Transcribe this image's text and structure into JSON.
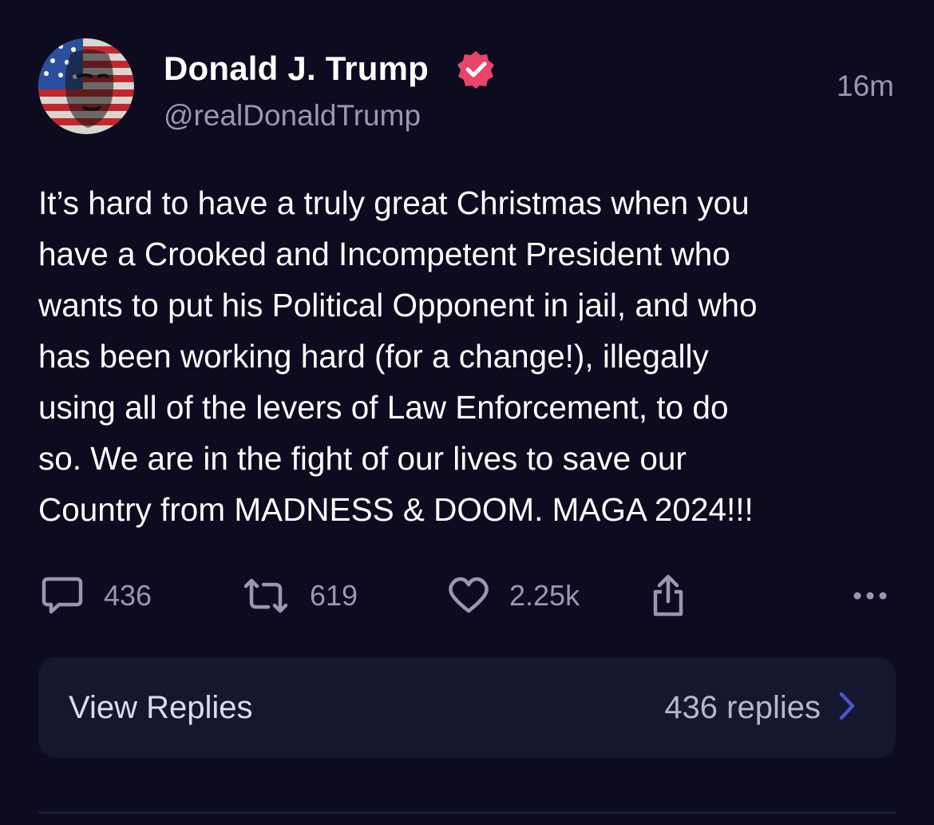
{
  "post": {
    "author": {
      "display_name": "Donald J. Trump",
      "handle": "@realDonaldTrump",
      "verified": true,
      "verified_badge_icon": "verified-badge-icon",
      "avatar_icon": "flag-portrait-avatar"
    },
    "timestamp": "16m",
    "body": "It’s hard to have a truly great Christmas when you\nhave a Crooked and Incompetent President who\nwants to put his Political Opponent in jail, and who\nhas been working hard (for a change!), illegally\nusing all of the levers of Law Enforcement, to do\nso. We are in the fight of our lives to save our\nCountry from MADNESS & DOOM. MAGA 2024!!!",
    "actions": {
      "reply_count": "436",
      "repost_count": "619",
      "like_count": "2.25k",
      "reply_icon": "comment-icon",
      "repost_icon": "repost-icon",
      "like_icon": "heart-icon",
      "share_icon": "share-icon",
      "more_icon": "more-horizontal-icon"
    },
    "view_replies": {
      "label": "View Replies",
      "count_text": "436 replies",
      "chevron_icon": "chevron-right-icon"
    }
  },
  "colors": {
    "background": "#0c0b20",
    "card": "#17162f",
    "text_primary": "#ffffff",
    "text_secondary": "#9a98b0",
    "verified": "#e9446a",
    "chevron": "#4b53c9"
  }
}
